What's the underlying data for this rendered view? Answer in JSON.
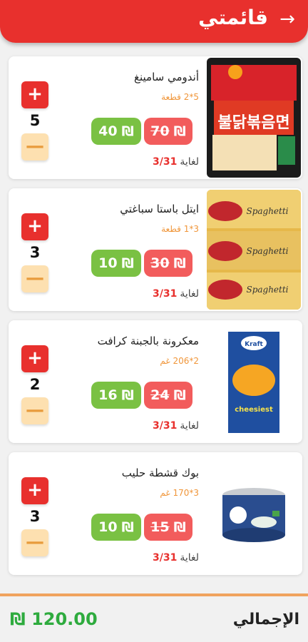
{
  "header": {
    "title": "قائمتي",
    "back_icon": "arrow-right-icon"
  },
  "currency": "₪",
  "items": [
    {
      "name": "أندومي سامينغ",
      "qty": "5*2 قطعة",
      "old_price": "70",
      "new_price": "40",
      "until_label": "لغاية",
      "until_date": "3/31",
      "count": "5",
      "image": "noodles-pack-image"
    },
    {
      "name": "ايتل باستا سباغتي",
      "qty": "3*1 قطعة",
      "old_price": "30",
      "new_price": "10",
      "until_label": "لغاية",
      "until_date": "3/31",
      "count": "3",
      "image": "spaghetti-pack-image"
    },
    {
      "name": "معكرونة بالجبنة كرافت",
      "qty": "2*206 غم",
      "old_price": "24",
      "new_price": "16",
      "until_label": "لغاية",
      "until_date": "3/31",
      "count": "2",
      "image": "mac-cheese-box-image"
    },
    {
      "name": "بوك قشطة حليب",
      "qty": "3*170 غم",
      "old_price": "15",
      "new_price": "10",
      "until_label": "لغاية",
      "until_date": "3/31",
      "count": "3",
      "image": "cream-can-image"
    }
  ],
  "footer": {
    "total_label": "الإجمالي",
    "total_value": "120.00"
  },
  "colors": {
    "primary": "#e8302d",
    "green": "#7ac143",
    "old_price": "#f25c5c",
    "minus_bg": "#fde0b0",
    "total": "#2eab3e"
  }
}
